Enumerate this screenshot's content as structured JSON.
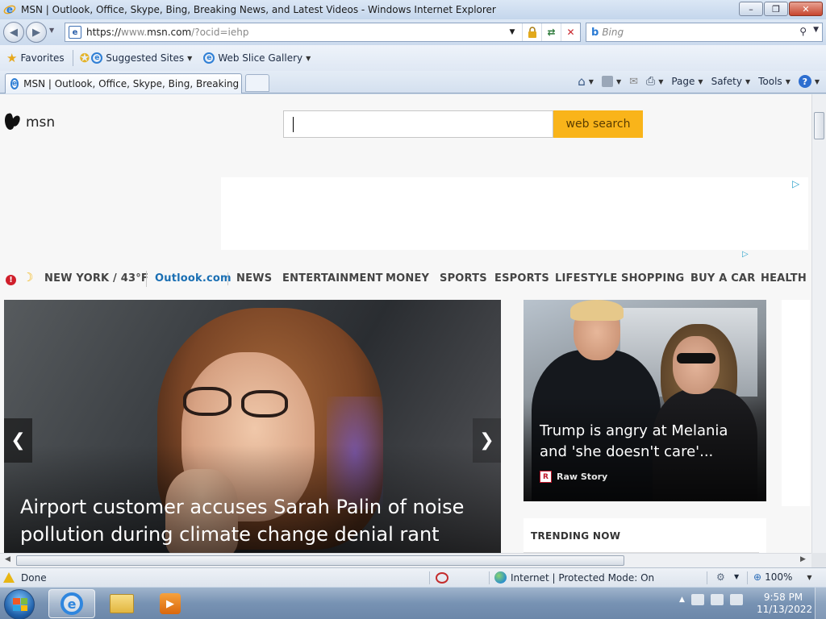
{
  "window": {
    "title": "MSN | Outlook, Office, Skype, Bing, Breaking News, and Latest Videos - Windows Internet Explorer",
    "minimize": "–",
    "restore": "❐",
    "close": "✕"
  },
  "address": {
    "scheme": "https://",
    "host_dim": "www.",
    "host": "msn.com",
    "path_dim": "/?ocid=iehp"
  },
  "search": {
    "placeholder": "Bing"
  },
  "favorites_bar": {
    "favorites": "Favorites",
    "suggested_sites": "Suggested Sites",
    "web_slice_gallery": "Web Slice Gallery"
  },
  "tab": {
    "title": "MSN | Outlook, Office, Skype, Bing, Breaking Ne..."
  },
  "command_bar": {
    "page": "Page",
    "safety": "Safety",
    "tools": "Tools",
    "help": "?"
  },
  "msn": {
    "logo_text": "msn",
    "search_button": "web search",
    "weather": "NEW YORK / 43°F",
    "nav": [
      "Outlook.com",
      "NEWS",
      "ENTERTAINMENT",
      "MONEY",
      "SPORTS",
      "ESPORTS",
      "LIFESTYLE",
      "SHOPPING",
      "BUY A CAR",
      "HEALTH"
    ],
    "hero": {
      "title": "Airport customer accuses Sarah Palin of noise pollution during climate change denial rant"
    },
    "side": {
      "title": "Trump is angry at Melania and 'she doesn't care'...",
      "source": "Raw Story",
      "source_logo": "R"
    },
    "trending": "TRENDING NOW"
  },
  "status": {
    "text": "Done",
    "zone": "Internet | Protected Mode: On",
    "zoom": "100%"
  },
  "taskbar": {
    "time": "9:58 PM",
    "date": "11/13/2022"
  },
  "colors": {
    "accent_search": "#f9b41a",
    "outlook_link": "#1a6fb3",
    "alert": "#d01f2b"
  }
}
